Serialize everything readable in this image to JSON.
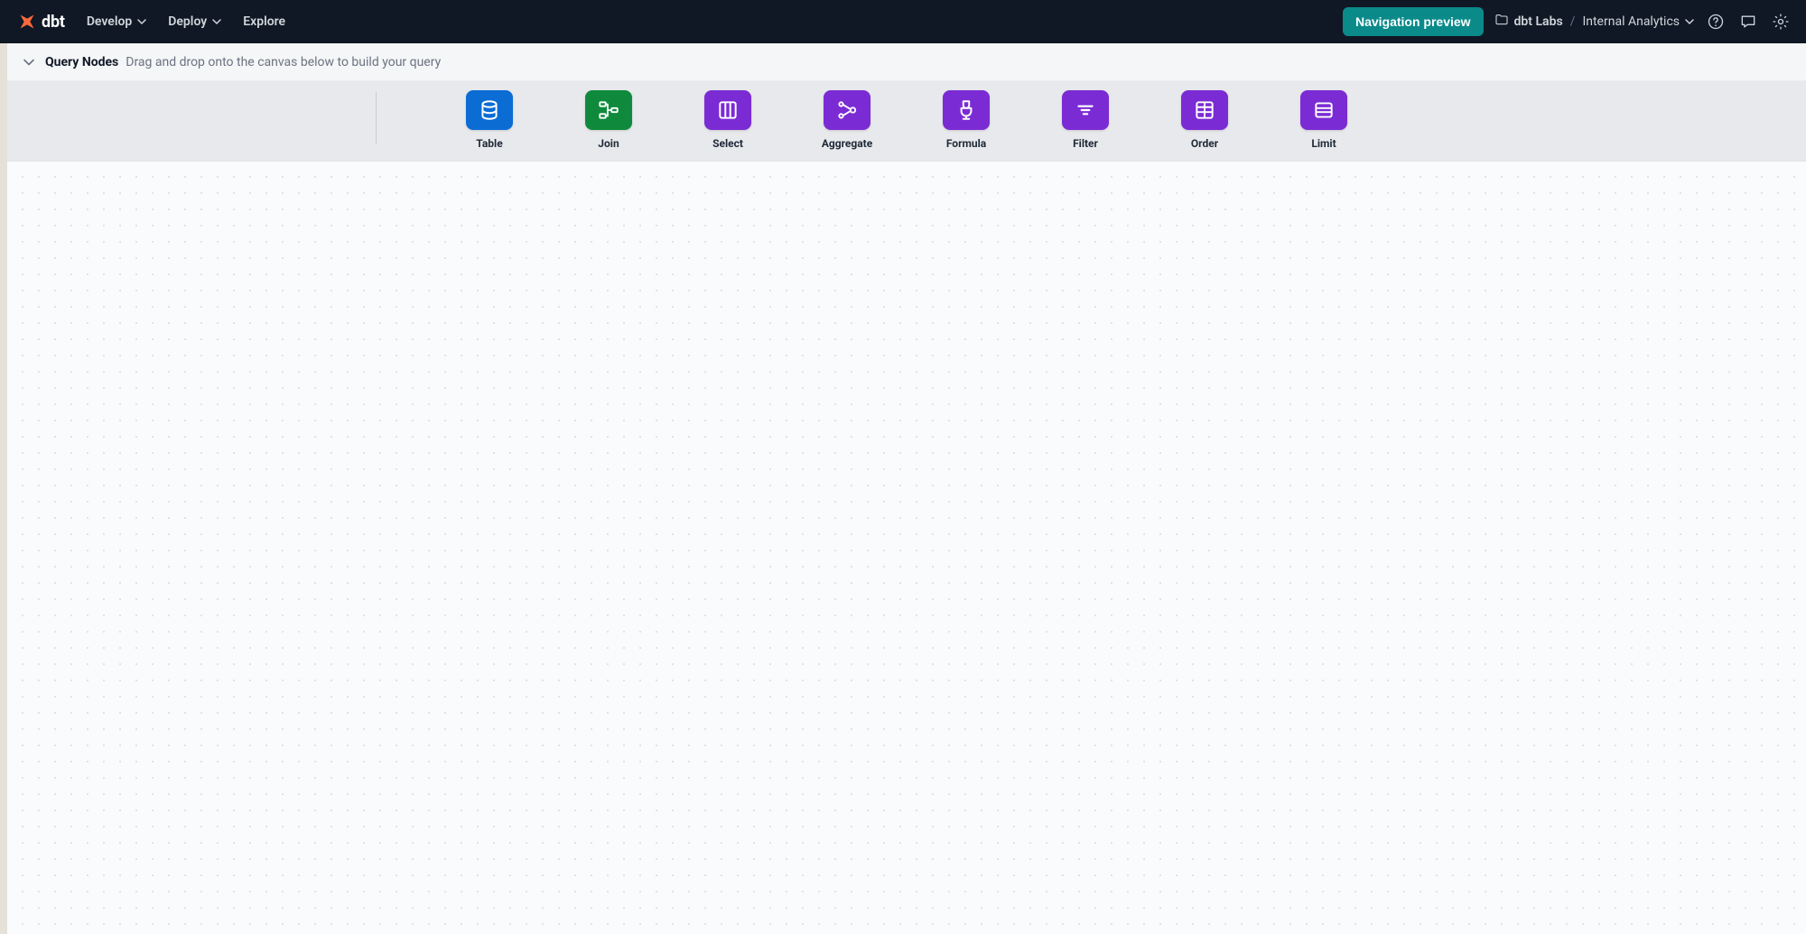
{
  "nav": {
    "brand_text": "dbt",
    "menu": {
      "develop": "Develop",
      "deploy": "Deploy",
      "explore": "Explore"
    },
    "preview_label": "Navigation preview",
    "breadcrumb_org": "dbt Labs",
    "breadcrumb_sep": "/",
    "breadcrumb_project": "Internal Analytics"
  },
  "query_nodes": {
    "title": "Query Nodes",
    "hint": "Drag and drop onto the canvas below to build your query",
    "nodes": {
      "table": "Table",
      "join": "Join",
      "select": "Select",
      "aggregate": "Aggregate",
      "formula": "Formula",
      "filter": "Filter",
      "order": "Order",
      "limit": "Limit"
    }
  },
  "colors": {
    "blue": "#0b6cd4",
    "green": "#0f8a3c",
    "purple": "#7b2bd4",
    "teal": "#0b8a8a",
    "navbg": "#0f1824"
  }
}
